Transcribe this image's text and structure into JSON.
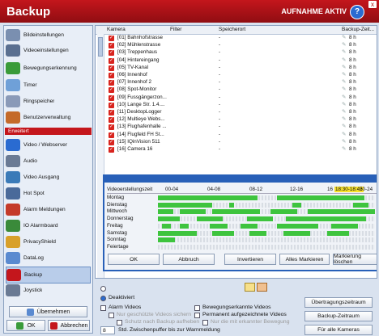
{
  "window": {
    "title": "Backup",
    "status": "AUFNAHME AKTIV",
    "help": "?",
    "close": "x"
  },
  "sidebar": {
    "items": [
      {
        "label": "Bildeinstellungen",
        "icon": "image-settings-icon",
        "color": "#7a8fb0"
      },
      {
        "label": "Videoeinstellungen",
        "icon": "video-settings-icon",
        "color": "#5a6f90"
      },
      {
        "label": "Bewegungserkennung",
        "icon": "motion-detection-icon",
        "color": "#3a9b3a"
      },
      {
        "label": "Timer",
        "icon": "timer-icon",
        "color": "#6fa0d8"
      },
      {
        "label": "Ringspeicher",
        "icon": "ring-storage-icon",
        "color": "#8a9ab8"
      },
      {
        "label": "Benutzerverwaltung",
        "icon": "user-management-icon",
        "color": "#c46a2a"
      }
    ],
    "section": "Erweitert",
    "items2": [
      {
        "label": "Video / Webserver",
        "icon": "webserver-icon",
        "color": "#2a6bd1"
      },
      {
        "label": "Audio",
        "icon": "audio-icon",
        "color": "#6a7a94"
      },
      {
        "label": "Video Ausgang",
        "icon": "video-output-icon",
        "color": "#3a7ab8"
      },
      {
        "label": "Hot Spot",
        "icon": "hotspot-icon",
        "color": "#4a6a9a"
      },
      {
        "label": "Alarm Meldungen",
        "icon": "alarm-messages-icon",
        "color": "#c43a2a"
      },
      {
        "label": "IO Alarmboard",
        "icon": "io-alarmboard-icon",
        "color": "#3a8a3a"
      },
      {
        "label": "PrivacyShield",
        "icon": "privacy-shield-icon",
        "color": "#d8a02a"
      },
      {
        "label": "DataLog",
        "icon": "datalog-icon",
        "color": "#5a8ad0"
      },
      {
        "label": "Backup",
        "icon": "backup-icon",
        "color": "#c4161c"
      },
      {
        "label": "Joystick",
        "icon": "joystick-icon",
        "color": "#6a7a94"
      }
    ],
    "uebernehmen": "Übernehmen",
    "ok": "OK",
    "abbrechen": "Abbrechen"
  },
  "list": {
    "headers": {
      "kamera": "Kamera",
      "filter": "Filter",
      "speicherort": "Speicherort",
      "backup": "Backup-Zeit..."
    },
    "rows": [
      {
        "name": "[01] Bahnhofstrasse",
        "speicherort": "-",
        "zeit": "8 h"
      },
      {
        "name": "[02] Mühlenstrasse",
        "speicherort": "-",
        "zeit": "8 h"
      },
      {
        "name": "[03] Treppenhaus",
        "speicherort": "-",
        "zeit": "8 h"
      },
      {
        "name": "[04] Hintereingang",
        "speicherort": "-",
        "zeit": "8 h"
      },
      {
        "name": "[05] TV-Kanal",
        "speicherort": "-",
        "zeit": "8 h"
      },
      {
        "name": "[06] Innenhof",
        "speicherort": "-",
        "zeit": "8 h"
      },
      {
        "name": "[07] Innenhof 2",
        "speicherort": "-",
        "zeit": "8 h"
      },
      {
        "name": "[08] Spot-Monitor",
        "speicherort": "-",
        "zeit": "8 h"
      },
      {
        "name": "[09] Fussgängerzon...",
        "speicherort": "-",
        "zeit": "8 h"
      },
      {
        "name": "[10] Lange Str. 1.4....",
        "speicherort": "-",
        "zeit": "8 h"
      },
      {
        "name": "[11] DesktopLogger",
        "speicherort": "-",
        "zeit": "8 h"
      },
      {
        "name": "[12] Multieye Webs...",
        "speicherort": "-",
        "zeit": "8 h"
      },
      {
        "name": "[13] Flughafenhalle ...",
        "speicherort": "-",
        "zeit": "8 h"
      },
      {
        "name": "[14] Flugfeld FH St...",
        "speicherort": "-",
        "zeit": "8 h"
      },
      {
        "name": "[15] IQinVision 511",
        "speicherort": "-",
        "zeit": "8 h"
      },
      {
        "name": "[16] Camera 16",
        "speicherort": "-",
        "zeit": "8 h"
      }
    ]
  },
  "schedule": {
    "label": "Videoerstellungszeit",
    "ticks": [
      "00-04",
      "04-08",
      "08-12",
      "12-16",
      "16",
      "18:30-18:45",
      "20-24"
    ],
    "days": [
      {
        "day": "Montag",
        "segs": [
          [
            0,
            0.46
          ],
          [
            0.55,
            0.95
          ]
        ]
      },
      {
        "day": "Dienstag",
        "segs": [
          [
            0,
            0.25
          ],
          [
            0.33,
            0.35
          ],
          [
            0.62,
            0.66
          ],
          [
            0.9,
            0.97
          ]
        ]
      },
      {
        "day": "Mittwoch",
        "segs": [
          [
            0,
            0.07
          ],
          [
            0.1,
            0.22
          ],
          [
            0.25,
            0.47
          ],
          [
            0.52,
            0.64
          ],
          [
            0.69,
            1.0
          ]
        ]
      },
      {
        "day": "Donnerstag",
        "segs": [
          [
            0,
            0.1
          ],
          [
            0.18,
            0.3
          ],
          [
            0.41,
            0.53
          ],
          [
            0.59,
            0.96
          ]
        ]
      },
      {
        "day": "Freitag",
        "segs": [
          [
            0.02,
            0.06
          ],
          [
            0.1,
            0.14
          ],
          [
            0.24,
            0.32
          ],
          [
            0.38,
            0.46
          ],
          [
            0.55,
            0.74
          ],
          [
            0.8,
            0.92
          ]
        ]
      },
      {
        "day": "Samstag",
        "segs": [
          [
            0,
            0.18
          ],
          [
            0.25,
            0.35
          ],
          [
            0.42,
            0.5
          ],
          [
            0.58,
            0.7
          ],
          [
            0.78,
            0.88
          ]
        ]
      },
      {
        "day": "Sonntag",
        "segs": [
          [
            0,
            0.08
          ]
        ]
      },
      {
        "day": "Feiertage",
        "segs": []
      }
    ],
    "buttons": {
      "ok": "OK",
      "abbruch": "Abbruch",
      "invertieren": "Invertieren",
      "alles": "Alles Markieren",
      "loeschen": "Markierung löschen"
    }
  },
  "options": {
    "deaktiviert": "Deaktiviert",
    "alarm_videos": "Alarm Videos",
    "nur_geschuetzte": "Nur geschützte Videos sichern",
    "schutz": "Schutz nach Backup aufheben",
    "bewegung": "Bewegungserkannte Videos",
    "permanent": "Permanent aufgezeichnete Videos",
    "nur_die_mit": "Nur die mit erkannter Bewegung",
    "puffer_value": "8",
    "puffer_text": "Std. Zwischenpuffer bis zur Warnmeldung",
    "btn_uebertragung": "Übertragungszeitraum",
    "btn_backupzeit": "Backup-Zeitraum",
    "btn_alle": "Für alle Kameras"
  }
}
